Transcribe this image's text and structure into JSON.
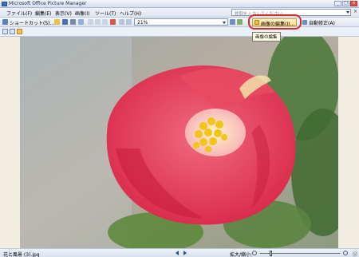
{
  "window": {
    "title": "Microsoft Office Picture Manager",
    "buttons": [
      "_",
      "□",
      "×"
    ]
  },
  "menubar": {
    "items": [
      "ファイル(F)",
      "編集(E)",
      "表示(V)",
      "画像(I)",
      "ツール(T)",
      "ヘルプ(H)"
    ],
    "help_placeholder": "質問を入力してください",
    "close": "×"
  },
  "toolbar": {
    "shortcut_label": "ショートカット(S)...",
    "zoom_value": "21%",
    "edit_picture_label": "画像の編集(I)...",
    "auto_correct_label": "自動修正(A)"
  },
  "tooltip": {
    "text": "画像の編集"
  },
  "photo": {
    "subject": "red camellia flower"
  },
  "statusbar": {
    "filename": "花と風景 (3).jpg",
    "zoom_label": "拡大/縮小:",
    "zoom_level": 0.13
  },
  "colors": {
    "highlight": "#d42a2a",
    "accent": "#f7c14d",
    "chrome": "#dfe6f2"
  }
}
